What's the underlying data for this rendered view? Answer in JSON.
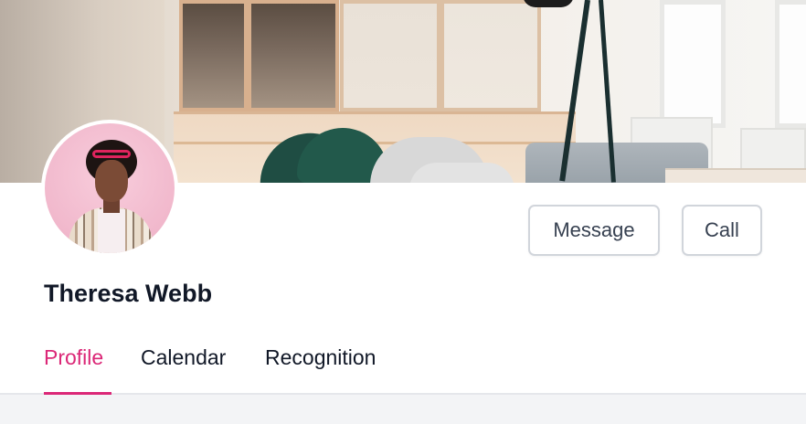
{
  "profile": {
    "name": "Theresa Webb",
    "avatar_icon": "avatar-photo",
    "cover_icon": "cover-photo"
  },
  "actions": {
    "message_label": "Message",
    "call_label": "Call"
  },
  "tabs": [
    {
      "label": "Profile",
      "active": true
    },
    {
      "label": "Calendar",
      "active": false
    },
    {
      "label": "Recognition",
      "active": false
    }
  ],
  "colors": {
    "accent": "#db2777",
    "text": "#111827",
    "button_border": "#d1d5db",
    "content_background": "#f3f4f6"
  }
}
